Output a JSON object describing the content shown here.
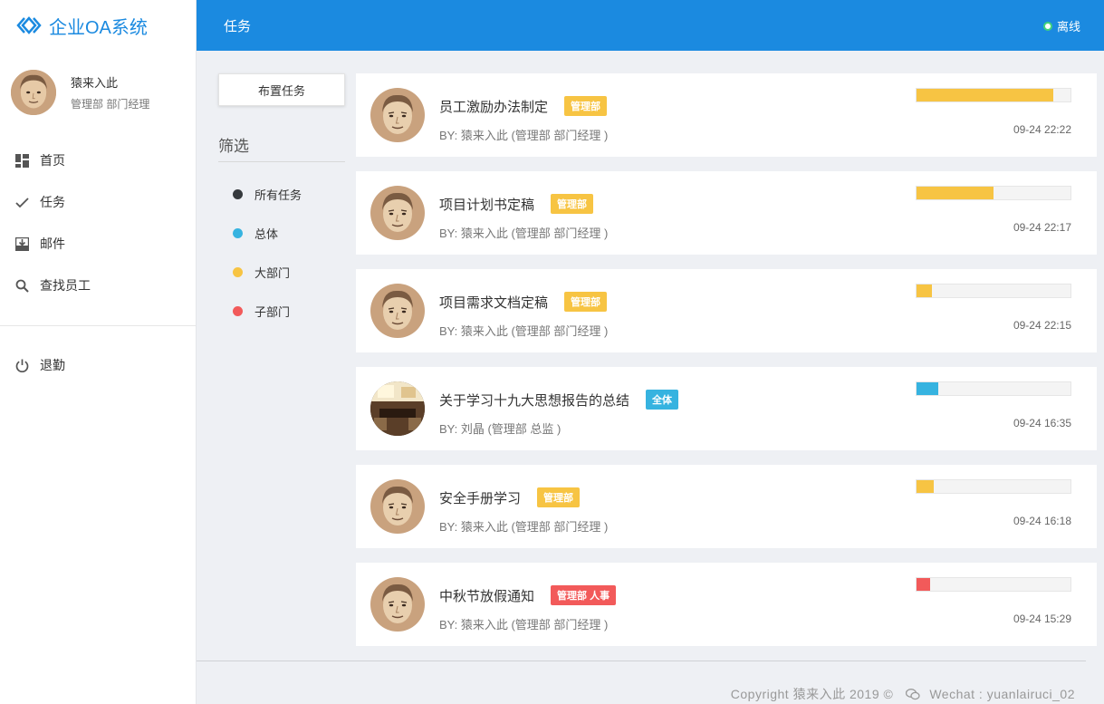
{
  "app": {
    "title": "企业OA系统"
  },
  "user": {
    "name": "猿来入此",
    "dept": "管理部 部门经理"
  },
  "nav": [
    {
      "label": "首页",
      "icon": "dashboard-icon"
    },
    {
      "label": "任务",
      "icon": "check-icon"
    },
    {
      "label": "邮件",
      "icon": "inbox-icon"
    },
    {
      "label": "查找员工",
      "icon": "search-icon"
    }
  ],
  "nav_bottom": {
    "label": "退勤",
    "icon": "power-icon"
  },
  "header": {
    "title": "任务",
    "status": "离线"
  },
  "assign_button": "布置任务",
  "filter": {
    "heading": "筛选",
    "items": [
      {
        "label": "所有任务",
        "color": "#35393d"
      },
      {
        "label": "总体",
        "color": "#36b3e0"
      },
      {
        "label": "大部门",
        "color": "#f7c443"
      },
      {
        "label": "子部门",
        "color": "#f25a5a"
      }
    ]
  },
  "tasks": [
    {
      "title": "员工激励办法制定",
      "badge": "管理部",
      "badge_color": "#f7c443",
      "by": "BY: 猿来入此 (管理部 部门经理 )",
      "progress": 0.89,
      "progress_color": "#f7c443",
      "time": "09-24 22:22",
      "avatar": "person"
    },
    {
      "title": "项目计划书定稿",
      "badge": "管理部",
      "badge_color": "#f7c443",
      "by": "BY: 猿来入此 (管理部 部门经理 )",
      "progress": 0.5,
      "progress_color": "#f7c443",
      "time": "09-24 22:17",
      "avatar": "person"
    },
    {
      "title": "项目需求文档定稿",
      "badge": "管理部",
      "badge_color": "#f7c443",
      "by": "BY: 猿来入此 (管理部 部门经理 )",
      "progress": 0.1,
      "progress_color": "#f7c443",
      "time": "09-24 22:15",
      "avatar": "person"
    },
    {
      "title": "关于学习十九大思想报告的总结",
      "badge": "全体",
      "badge_color": "#36b3e0",
      "by": "BY: 刘晶 (管理部 总监 )",
      "progress": 0.14,
      "progress_color": "#36b3e0",
      "time": "09-24 16:35",
      "avatar": "room"
    },
    {
      "title": "安全手册学习",
      "badge": "管理部",
      "badge_color": "#f7c443",
      "by": "BY: 猿来入此 (管理部 部门经理 )",
      "progress": 0.11,
      "progress_color": "#f7c443",
      "time": "09-24 16:18",
      "avatar": "person"
    },
    {
      "title": "中秋节放假通知",
      "badge": "管理部 人事",
      "badge_color": "#f25a5a",
      "by": "BY: 猿来入此 (管理部 部门经理 )",
      "progress": 0.09,
      "progress_color": "#f25a5a",
      "time": "09-24 15:29",
      "avatar": "person"
    }
  ],
  "footer": {
    "copyright": "Copyright 猿来入此 2019 ©",
    "wechat": "Wechat : yuanlairuci_02"
  }
}
